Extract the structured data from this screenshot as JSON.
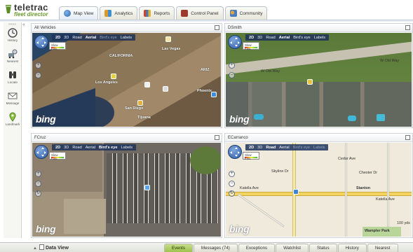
{
  "app": {
    "brand_name": "teletrac",
    "brand_sub": "fleet director"
  },
  "colors": {
    "brand_green": "#6a9c2e",
    "map_toolbar": "#1e325a",
    "events_tab": "#9ec24d",
    "sidebar_bg": "#f6f6f3"
  },
  "tabs": [
    {
      "label": "Map View",
      "icon": "globe-icon",
      "active": true
    },
    {
      "label": "Analytics",
      "icon": "grid-chart-icon",
      "active": false
    },
    {
      "label": "Reports",
      "icon": "bar-chart-icon",
      "active": false
    },
    {
      "label": "Control Panel",
      "icon": "control-panel-icon",
      "active": false
    },
    {
      "label": "Community",
      "icon": "people-icon",
      "active": false
    }
  ],
  "sidebar": {
    "top_mark": "««««",
    "collapse_glyph": "«",
    "items": [
      {
        "label": "History",
        "icon": "clock-icon"
      },
      {
        "label": "Nearest",
        "icon": "nearest-icon"
      },
      {
        "label": "Locate",
        "icon": "binoculars-icon"
      },
      {
        "label": "Message",
        "icon": "envelope-icon"
      },
      {
        "label": "Landmark",
        "icon": "pin-icon"
      }
    ]
  },
  "map_controls": {
    "mode_2d": "2D",
    "mode_3d": "3D",
    "road": "Road",
    "aerial": "Aerial",
    "birdseye": "Bird's eye",
    "labels": "Labels",
    "speed_legend": "Slow Fast",
    "zoom_in": "+",
    "zoom_out": "−",
    "rotate": "↻",
    "bing": "bing"
  },
  "panels": [
    {
      "title": "All Vehicles",
      "active_mode": "Aerial",
      "labels": [
        "Los Angeles",
        "San Diego",
        "Tijuana",
        "Phoenix",
        "ARIZ",
        "Las Vegas",
        "CALIFORNIA"
      ]
    },
    {
      "title": "DSmith",
      "active_mode": "Aerial",
      "labels": [
        "W Old Way",
        "W Old Way"
      ]
    },
    {
      "title": "FCruz",
      "active_mode": "Bird's eye",
      "labels": []
    },
    {
      "title": "ECarranco",
      "active_mode": "Road",
      "labels": [
        "Stanton",
        "Katella Ave",
        "Katella Ave",
        "Skyline Dr",
        "Chester Dr",
        "Cedar Ave",
        "Wampler Park"
      ],
      "scale": "100 yds"
    }
  ],
  "bottom": {
    "data_view_label": "Data View",
    "tabs": [
      {
        "label": "Events",
        "active": true
      },
      {
        "label": "Messages (74)",
        "active": false
      },
      {
        "label": "Exceptions",
        "active": false
      },
      {
        "label": "Watchlist",
        "active": false
      },
      {
        "label": "Status",
        "active": false
      },
      {
        "label": "History",
        "active": false
      },
      {
        "label": "Nearest",
        "active": false
      }
    ]
  }
}
